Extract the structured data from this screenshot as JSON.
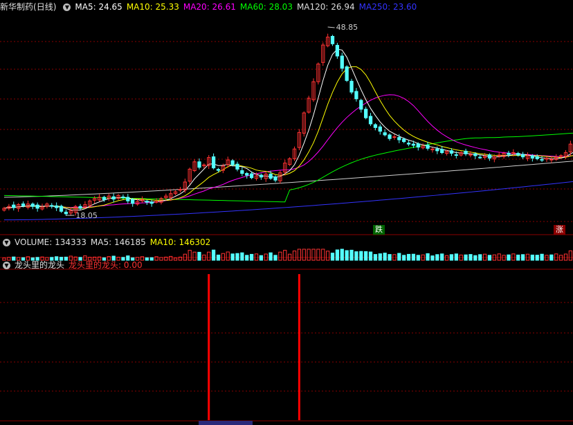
{
  "stock": {
    "name": "新华制药",
    "period": "(日线)"
  },
  "main": {
    "ma_labels": [
      {
        "label": "MA5: 24.65",
        "color": "#ffffff"
      },
      {
        "label": "MA10: 25.33",
        "color": "#ffff00"
      },
      {
        "label": "MA20: 26.61",
        "color": "#ff00ff"
      },
      {
        "label": "MA60: 28.03",
        "color": "#00ff00"
      },
      {
        "label": "MA120: 26.94",
        "color": "#dddddd"
      },
      {
        "label": "MA250: 23.60",
        "color": "#3333ff"
      }
    ],
    "high_label": "48.85",
    "low_label": "18.05",
    "fall_badge": "跌",
    "rise_badge": "涨"
  },
  "volume": {
    "title": "VOLUME: 134333",
    "ma5": "MA5: 146185",
    "ma10": "MA10: 146302"
  },
  "indicator": {
    "title": "龙头里的龙头",
    "value_label": "龙头里的龙头: 0.00"
  },
  "colors": {
    "up": "#ff3232",
    "down": "#54ffff",
    "grid": "#8b0000",
    "ma5": "#ffffff",
    "ma10": "#ffff00",
    "ma20": "#ff00ff",
    "ma60": "#00ff00",
    "ma120": "#d0d0d0",
    "ma250": "#3333ff",
    "signal": "#ff0000"
  },
  "chart_data": {
    "type": "candlestick",
    "ylim": [
      15,
      51
    ],
    "highest": 48.85,
    "lowest": 18.05,
    "closes": [
      19.2,
      19.5,
      19.3,
      19.8,
      19.6,
      19.9,
      19.5,
      19.2,
      19.4,
      19.9,
      19.6,
      19.3,
      18.7,
      18.3,
      18.8,
      19.5,
      19.2,
      19.8,
      20.4,
      20.8,
      21.0,
      20.6,
      21.2,
      20.7,
      21.3,
      21.0,
      20.4,
      20.0,
      20.3,
      20.6,
      20.2,
      20.0,
      20.3,
      20.8,
      21.2,
      21.6,
      21.9,
      22.3,
      23.5,
      25.6,
      26.8,
      25.9,
      26.3,
      27.5,
      25.8,
      25.4,
      26.1,
      27.1,
      26.3,
      25.6,
      24.9,
      24.6,
      24.2,
      24.5,
      24.3,
      24.8,
      24.1,
      23.8,
      25.0,
      26.6,
      27.3,
      28.9,
      31.6,
      34.8,
      37.2,
      39.9,
      42.8,
      45.9,
      47.2,
      46.1,
      44.1,
      42.1,
      40.1,
      38.2,
      37.1,
      35.4,
      34.0,
      33.0,
      32.4,
      31.8,
      31.2,
      30.6,
      30.9,
      30.4,
      30.1,
      29.7,
      29.5,
      29.2,
      29.4,
      29.0,
      28.9,
      28.6,
      28.3,
      28.5,
      28.2,
      27.9,
      28.3,
      28.1,
      28.0,
      27.8,
      27.5,
      27.7,
      27.4,
      27.6,
      27.9,
      28.2,
      28.0,
      28.3,
      27.9,
      27.6,
      27.8,
      27.4,
      27.3,
      27.1,
      27.4,
      27.2,
      27.5,
      27.8,
      28.3,
      29.7,
      29.2
    ],
    "ma60_end": 28.03,
    "ma120_end": 26.94,
    "ma250_end": 23.6,
    "ma5_end": 24.65,
    "ma10_end": 25.33,
    "ma20_end": 26.61,
    "volume_ma5": 146185,
    "volume_ma10": 146302,
    "signals": [
      {
        "index": 43,
        "value": 1
      },
      {
        "index": 62,
        "value": 1
      }
    ]
  }
}
